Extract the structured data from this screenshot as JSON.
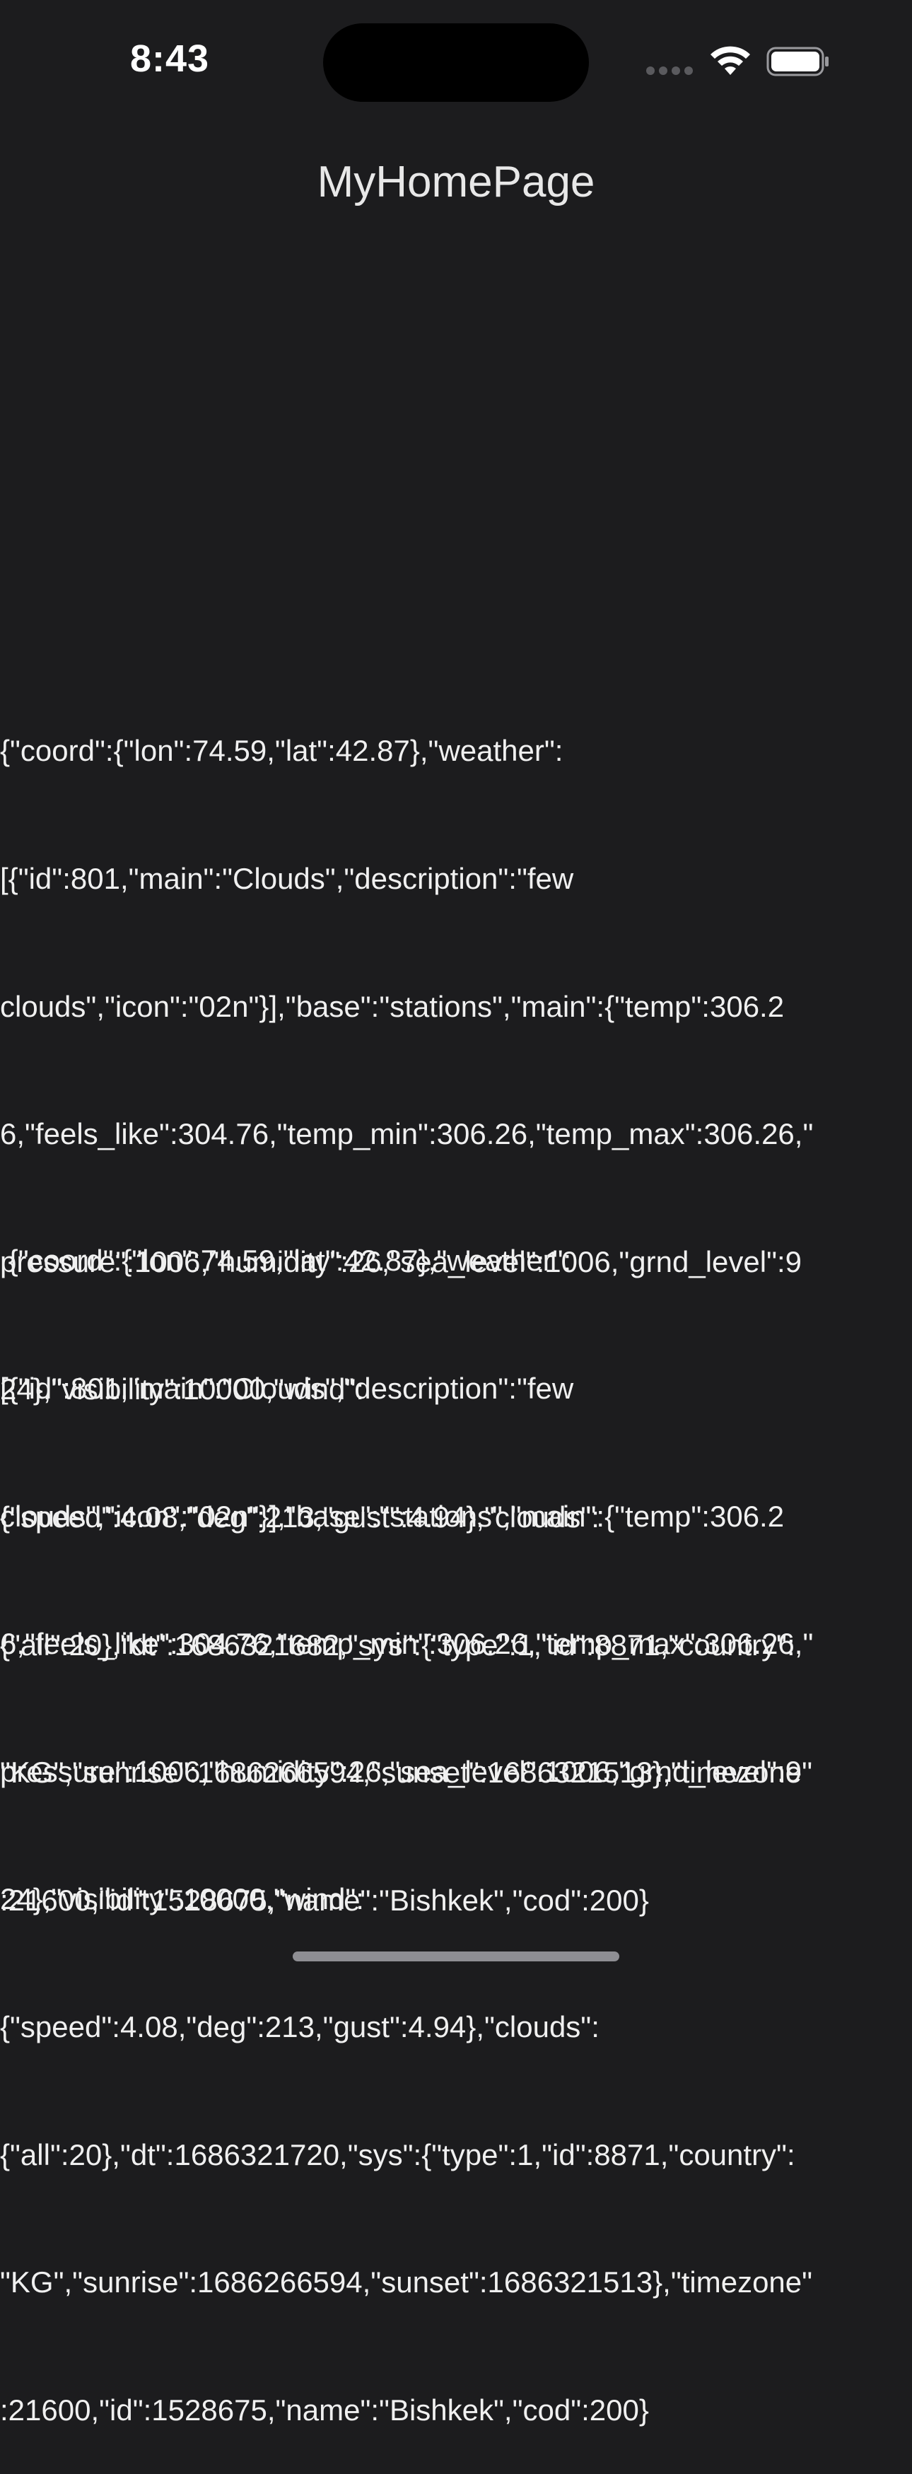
{
  "status_bar": {
    "time": "8:43",
    "icons": [
      "cellular-signal-icon",
      "wifi-icon",
      "battery-icon"
    ]
  },
  "nav": {
    "title": "MyHomePage"
  },
  "responses": [
    {
      "lines": [
        "{\"coord\":{\"lon\":74.59,\"lat\":42.87},\"weather\":",
        "[{\"id\":801,\"main\":\"Clouds\",\"description\":\"few",
        "clouds\",\"icon\":\"02n\"}],\"base\":\"stations\",\"main\":{\"temp\":306.2",
        "6,\"feels_like\":304.76,\"temp_min\":306.26,\"temp_max\":306.26,\"",
        "pressure\":1006,\"humidity\":26,\"sea_level\":1006,\"grnd_level\":9",
        "24},\"visibility\":10000,\"wind\":",
        "{\"speed\":4.08,\"deg\":213,\"gust\":4.94},\"clouds\":",
        "{\"all\":20},\"dt\":1686321682,\"sys\":{\"type\":1,\"id\":8871,\"country\":",
        "\"KG\",\"sunrise\":1686266594,\"sunset\":1686321513},\"timezone\"",
        ":21600,\"id\":1528675,\"name\":\"Bishkek\",\"cod\":200}"
      ]
    },
    {
      "lines": [
        " {\"coord\":{\"lon\":74.59,\"lat\":42.87},\"weather\":",
        "[{\"id\":801,\"main\":\"Clouds\",\"description\":\"few",
        "clouds\",\"icon\":\"02n\"}],\"base\":\"stations\",\"main\":{\"temp\":306.2",
        "6,\"feels_like\":304.76,\"temp_min\":306.26,\"temp_max\":306.26,\"",
        "pressure\":1006,\"humidity\":26,\"sea_level\":1006,\"grnd_level\":9",
        "24},\"visibility\":10000,\"wind\":",
        "{\"speed\":4.08,\"deg\":213,\"gust\":4.94},\"clouds\":",
        "{\"all\":20},\"dt\":1686321720,\"sys\":{\"type\":1,\"id\":8871,\"country\":",
        "\"KG\",\"sunrise\":1686266594,\"sunset\":1686321513},\"timezone\"",
        ":21600,\"id\":1528675,\"name\":\"Bishkek\",\"cod\":200}"
      ]
    }
  ],
  "colors": {
    "background": "#1c1c1e",
    "text": "#f0f0f0",
    "island": "#000000"
  }
}
